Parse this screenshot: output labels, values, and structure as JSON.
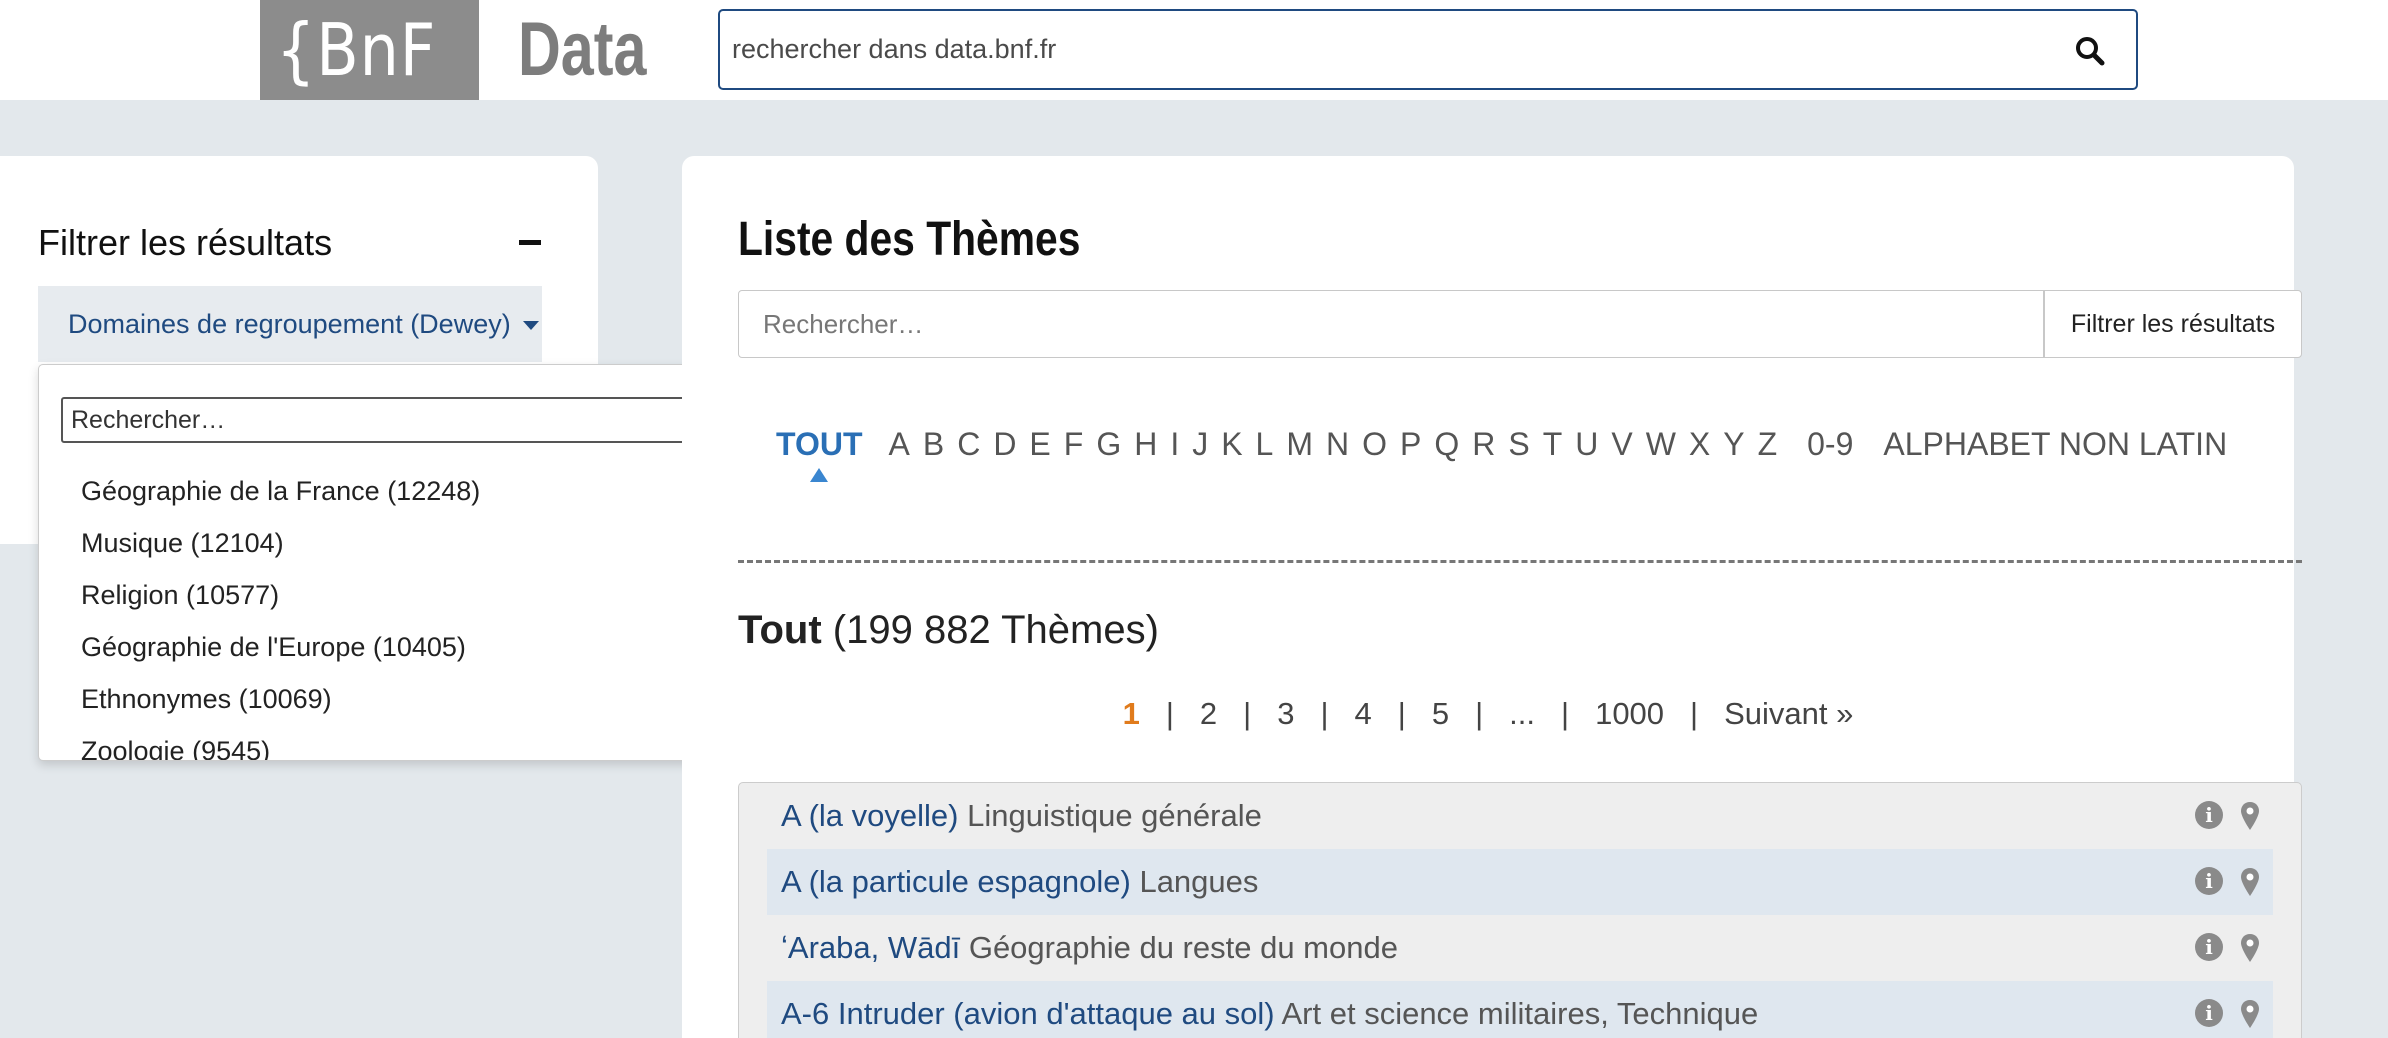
{
  "header": {
    "logo_text": "{BnF",
    "logo_word": "Data",
    "search_placeholder": "rechercher dans data.bnf.fr"
  },
  "filter": {
    "title": "Filtrer les résultats",
    "dewey_label": "Domaines de regroupement (Dewey)",
    "dropdown_search_placeholder": "Rechercher…",
    "options": [
      "Géographie de la France (12248)",
      "Musique (12104)",
      "Religion (10577)",
      "Géographie de l'Europe (10405)",
      "Ethnonymes (10069)",
      "Zoologie (9545)"
    ]
  },
  "main": {
    "title": "Liste des Thèmes",
    "search_placeholder": "Rechercher…",
    "filter_button": "Filtrer les résultats",
    "alphabet_active": "TOUT",
    "alphabet": [
      "A",
      "B",
      "C",
      "D",
      "E",
      "F",
      "G",
      "H",
      "I",
      "J",
      "K",
      "L",
      "M",
      "N",
      "O",
      "P",
      "Q",
      "R",
      "S",
      "T",
      "U",
      "V",
      "W",
      "X",
      "Y",
      "Z"
    ],
    "alphabet_digits": "0-9",
    "alphabet_nonlatin": "ALPHABET NON LATIN",
    "count_bold": "Tout",
    "count_rest": "(199 882 Thèmes)",
    "pager": {
      "current": "1",
      "pages": [
        "2",
        "3",
        "4",
        "5",
        "...",
        "1000"
      ],
      "next": "Suivant »"
    },
    "results": [
      {
        "name": "A (la voyelle)",
        "category": "Linguistique générale"
      },
      {
        "name": "A (la particule espagnole)",
        "category": "Langues"
      },
      {
        "name": "ʻAraba, Wādī",
        "category": "Géographie du reste du monde"
      },
      {
        "name": "A-6 Intruder (avion d'attaque au sol)",
        "category": "Art et science militaires, Technique"
      }
    ]
  },
  "colors": {
    "link_blue": "#1f4a80",
    "active_letter": "#2a6fb5",
    "current_page": "#e07b1c",
    "logo_gray": "#8c8c8c"
  }
}
